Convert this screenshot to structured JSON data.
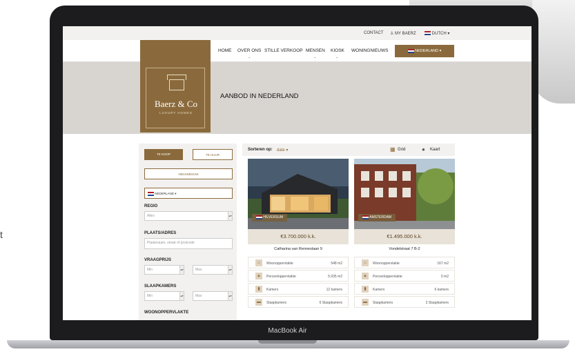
{
  "colors": {
    "brand": "#8a6a3c",
    "device": "#1c1c1e"
  },
  "side_text": "t",
  "device_label": "MacBook Air",
  "topbar": {
    "contact": "CONTACT",
    "my_baerz": "MY BAERZ",
    "language": "DUTCH"
  },
  "nav": {
    "items": [
      "HOME",
      "OVER ONS",
      "STILLE VERKOOP",
      "MENSEN",
      "KIOSK",
      "WONINGNIEUWS"
    ],
    "country_button": "NEDERLAND"
  },
  "logo": {
    "name": "Baerz & Co",
    "sub": "LUXURY HOMES"
  },
  "hero": {
    "title": "AANBOD IN NEDERLAND"
  },
  "filters": {
    "te_koop": "TE KOOP",
    "te_huur": "TE HUUR",
    "nieuwbouw": "NIEUWBOUW",
    "country": "NEDERLAND",
    "regio_label": "REGIO",
    "regio_value": "Alles",
    "plaats_label": "PLAATS/ADRES",
    "plaats_placeholder": "Plaatsnaam, straat of postcode",
    "vraagprijs_label": "VRAAGPRIJS",
    "min": "Min",
    "max": "Max",
    "slaapkamers_label": "SLAAPKAMERS",
    "woonoppervlakte_label": "WOONOPPERVLAKTE"
  },
  "results": {
    "sort_label": "Sorteren op:",
    "sort_value": "date",
    "grid_label": "Grid",
    "map_label": "Kaart",
    "cards": [
      {
        "location": "HILVERSUM",
        "price": "€3.700.000 k.k.",
        "address": "Catharina van Renneslaan 9",
        "features": [
          {
            "icon": "house-icon",
            "label": "Woonoppervlakte",
            "value": "548 m2"
          },
          {
            "icon": "plot-icon",
            "label": "Perceeloppervlakte",
            "value": "5.935 m2"
          },
          {
            "icon": "door-icon",
            "label": "Kamers",
            "value": "12 kamers"
          },
          {
            "icon": "bed-icon",
            "label": "Slaapkamers",
            "value": "6 Slaapkamers"
          }
        ]
      },
      {
        "location": "AMSTERDAM",
        "price": "€1.495.000 k.k.",
        "address": "Vondelstraat 7 B-2",
        "features": [
          {
            "icon": "house-icon",
            "label": "Woonoppervlakte",
            "value": "167 m2"
          },
          {
            "icon": "plot-icon",
            "label": "Perceeloppervlakte",
            "value": "0 m2"
          },
          {
            "icon": "door-icon",
            "label": "Kamers",
            "value": "6 kamers"
          },
          {
            "icon": "bed-icon",
            "label": "Slaapkamers",
            "value": "3 Slaapkamers"
          }
        ]
      }
    ]
  }
}
